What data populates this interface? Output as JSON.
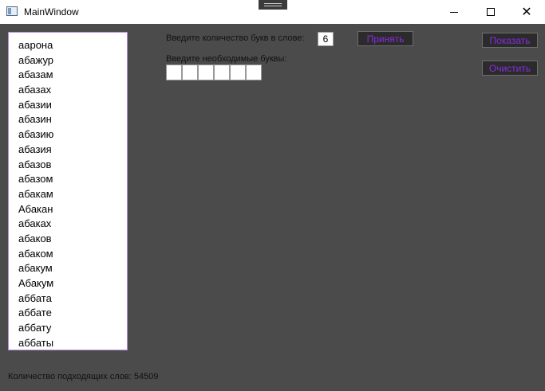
{
  "window": {
    "title": "MainWindow"
  },
  "word_list": [
    "аарона",
    "абажур",
    "абазам",
    "абазах",
    "абазии",
    "абазин",
    "абазию",
    "абазия",
    "абазов",
    "абазом",
    "абакам",
    "Абакан",
    "абаках",
    "абаков",
    "абаком",
    "абакум",
    "Абакум",
    "аббата",
    "аббате",
    "аббату",
    "аббаты"
  ],
  "form": {
    "count_label": "Введите количество букв в слове:",
    "count_value": "6",
    "letters_label": "Введите необходимые буквы:",
    "letters": [
      "",
      "",
      "",
      "",
      "",
      ""
    ]
  },
  "buttons": {
    "accept": "Принять",
    "show": "Показать",
    "clear": "Очистить"
  },
  "status": {
    "text": "Количество подходящих слов: 54509"
  },
  "colors": {
    "background": "#4b4b4b",
    "button_bg": "#2b2b2b",
    "button_text": "#8a2be2",
    "list_border": "#b48bd6"
  }
}
